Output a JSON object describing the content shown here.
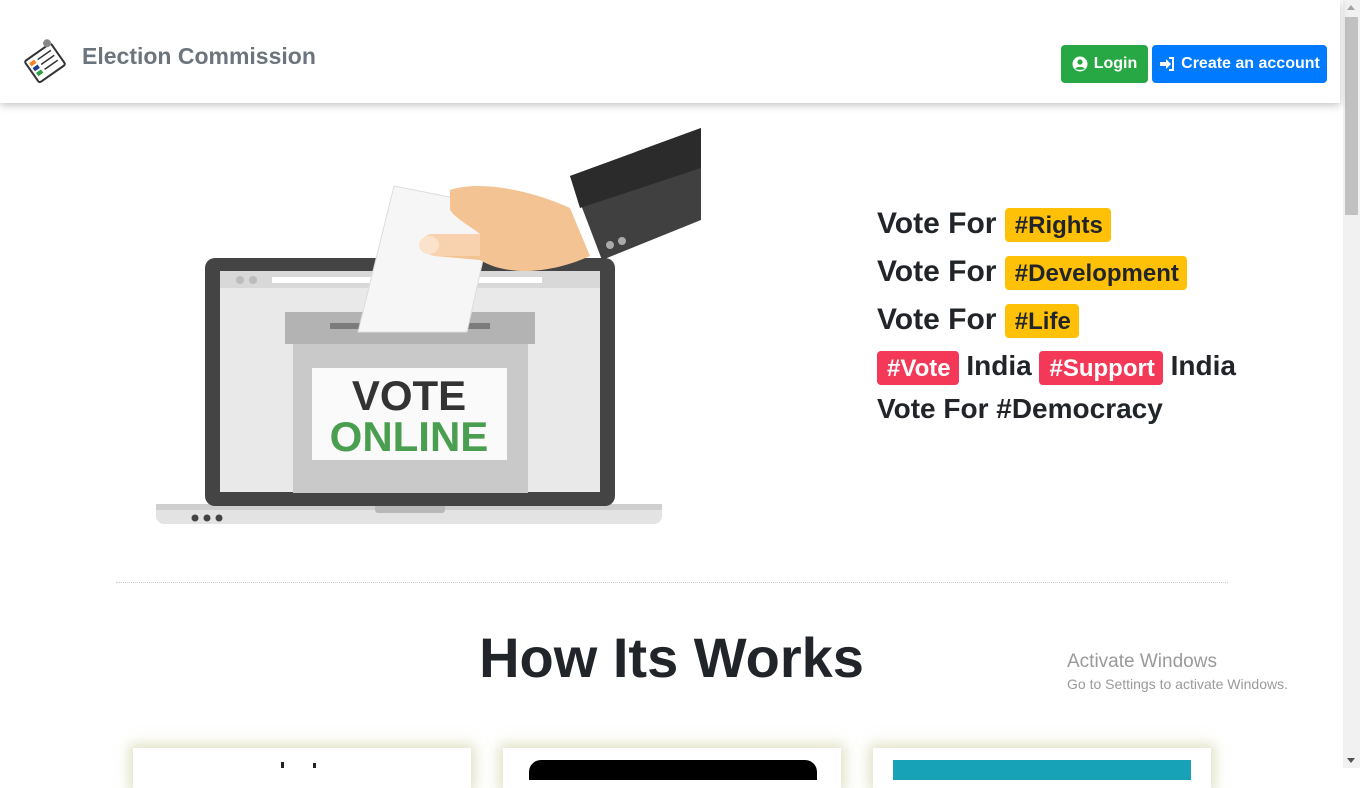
{
  "navbar": {
    "brand_title": "Election Commission",
    "login_label": "Login",
    "create_account_label": "Create an account"
  },
  "hero": {
    "ballot_text_line1": "VOTE",
    "ballot_text_line2": "ONLINE",
    "slogans": [
      {
        "prefix": "Vote For",
        "tag": "#Rights"
      },
      {
        "prefix": "Vote For",
        "tag": "#Development"
      },
      {
        "prefix": "Vote For",
        "tag": "#Life"
      }
    ],
    "line4": {
      "tag1": "#Vote",
      "word1": "India",
      "tag2": "#Support",
      "word2": "India"
    },
    "line5": "Vote For #Democracy"
  },
  "section": {
    "title": "How Its Works"
  },
  "watermark": {
    "line1": "Activate Windows",
    "line2": "Go to Settings to activate Windows."
  },
  "colors": {
    "success": "#28a745",
    "primary": "#007bff",
    "warning": "#ffc107",
    "danger": "#f33957"
  }
}
